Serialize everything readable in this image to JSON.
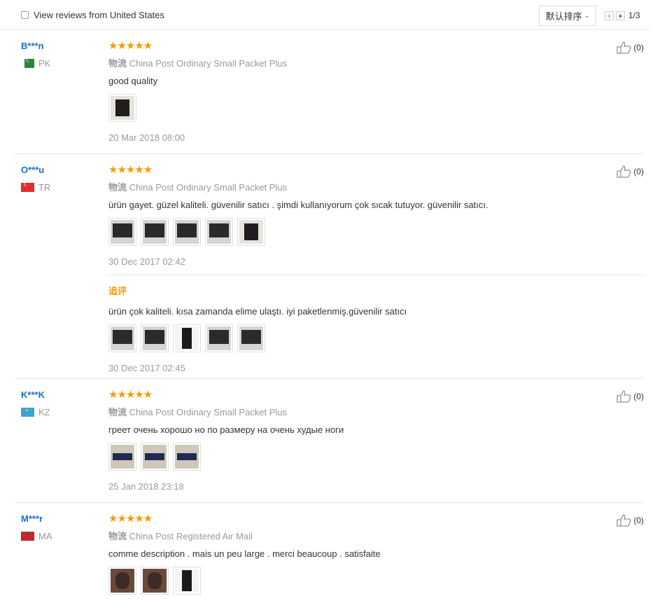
{
  "filter": {
    "label": "View reviews from United States"
  },
  "sort": {
    "label": "默认排序"
  },
  "pager": {
    "text": "1/3"
  },
  "rating_stars": "★★★★★",
  "shipping_prefix": "物流",
  "followup_label": "追评",
  "reviews": [
    {
      "user": "B***n",
      "country": "PK",
      "rating": 5,
      "shipping": "China Post Ordinary Small Packet Plus",
      "text": "good quality",
      "images": [
        "product-photo"
      ],
      "date": "20 Mar 2018 08:00",
      "likes": "(0)"
    },
    {
      "user": "O***u",
      "country": "TR",
      "rating": 5,
      "shipping": "China Post Ordinary Small Packet Plus",
      "text": "ürün gayet. güzel kaliteli. güvenilir satıcı . şimdi kullanıyorum çok sıcak tutuyor. güvenilir satıcı.",
      "images": [
        "product-photo",
        "product-photo",
        "product-photo",
        "product-photo",
        "product-photo"
      ],
      "date": "30 Dec 2017 02:42",
      "followup": {
        "text": "ürün çok kaliteli. kısa zamanda elime ulaştı. iyi paketlenmiş.güvenilir satıcı",
        "images": [
          "product-photo",
          "product-photo",
          "product-photo",
          "product-photo",
          "product-photo"
        ],
        "date": "30 Dec 2017 02:45"
      },
      "likes": "(0)"
    },
    {
      "user": "K***K",
      "country": "KZ",
      "rating": 5,
      "shipping": "China Post Ordinary Small Packet Plus",
      "text": "греет очень хорошо но по размеру на очень худые ноги",
      "images": [
        "product-photo",
        "product-photo",
        "product-photo"
      ],
      "date": "25 Jan 2018 23:18",
      "likes": "(0)"
    },
    {
      "user": "M***r",
      "country": "MA",
      "rating": 5,
      "shipping": "China Post Registered Air Mail",
      "text": "comme description . mais un peu large . merci beaucoup . satisfaite",
      "images": [
        "product-photo",
        "product-photo",
        "product-photo"
      ],
      "likes": "(0)"
    }
  ]
}
